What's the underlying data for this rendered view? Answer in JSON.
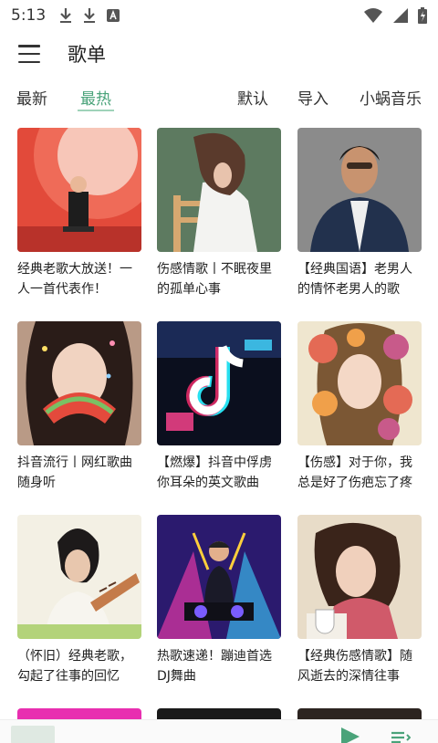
{
  "status_bar": {
    "time": "5:13",
    "left_icons": [
      "download-icon",
      "download-icon",
      "font-app-icon"
    ],
    "right_icons": [
      "wifi-icon",
      "signal-icon",
      "battery-icon"
    ]
  },
  "header": {
    "title": "歌单",
    "menu_icon": "hamburger-menu-icon"
  },
  "tabs": {
    "left": [
      {
        "label": "最新",
        "active": false
      },
      {
        "label": "最热",
        "active": true
      }
    ],
    "right": [
      {
        "label": "默认"
      },
      {
        "label": "导入"
      },
      {
        "label": "小蜗音乐"
      }
    ],
    "active_color": "#4aa37a"
  },
  "playlists": [
    {
      "title": "经典老歌大放送！一人一首代表作！"
    },
    {
      "title": "伤感情歌丨不眠夜里的孤单心事"
    },
    {
      "title": "【经典国语】老男人的情怀老男人的歌"
    },
    {
      "title": "抖音流行丨网红歌曲随身听"
    },
    {
      "title": "【燃爆】抖音中俘虏你耳朵的英文歌曲"
    },
    {
      "title": "【伤感】对于你，我总是好了伤疤忘了疼"
    },
    {
      "title": "（怀旧）经典老歌，勾起了往事的回忆"
    },
    {
      "title": "热歌速递！蹦迪首选DJ舞曲"
    },
    {
      "title": "【经典伤感情歌】随风逝去的深情往事"
    }
  ],
  "bottom_bar": {
    "play_icon": "play-icon",
    "list_icon": "playlist-icon"
  }
}
